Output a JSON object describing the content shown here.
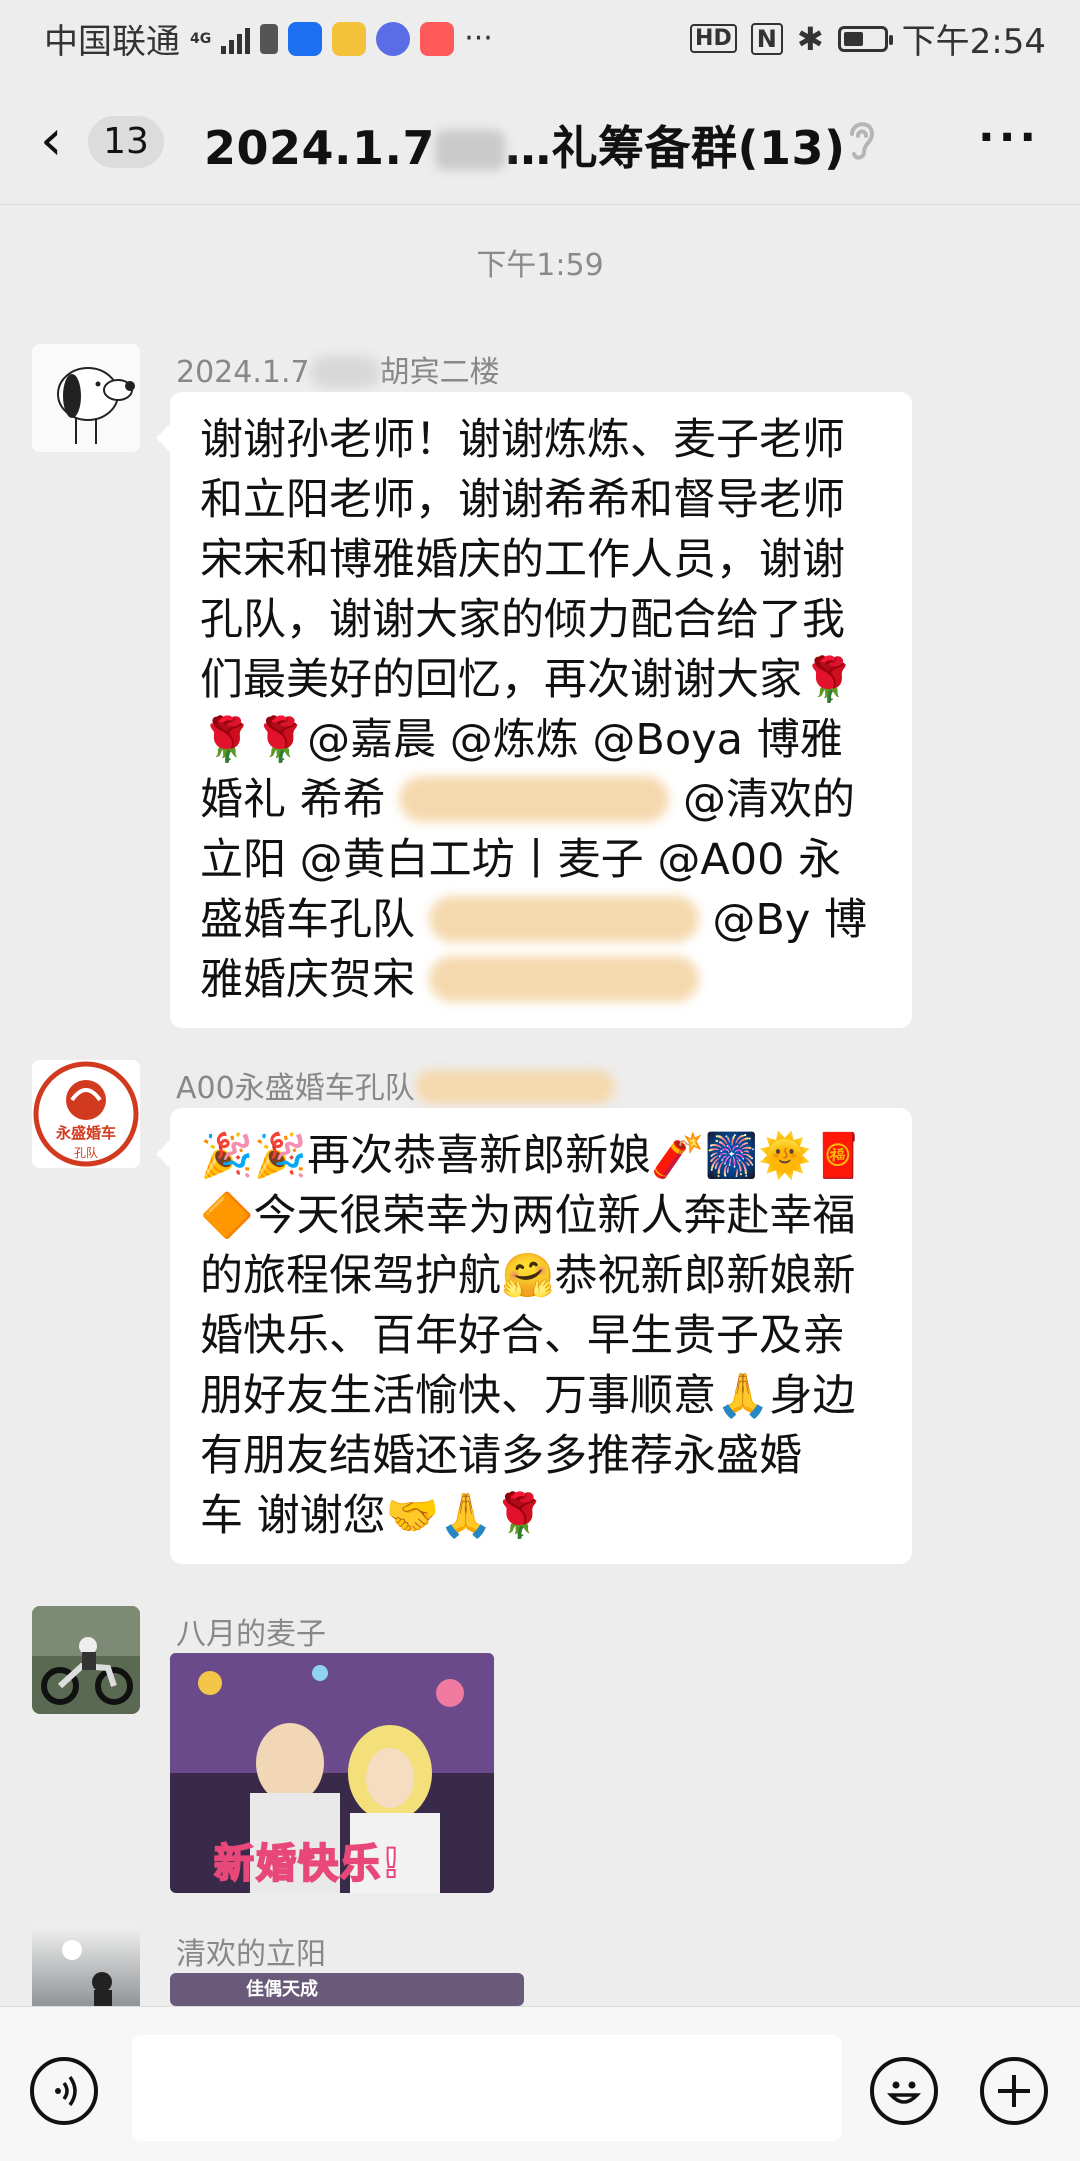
{
  "status_bar": {
    "carrier": "中国联通",
    "network": "4G",
    "time": "下午2:54",
    "battery_level": 0.5,
    "hd_label": "HD",
    "nfc_label": "N",
    "icons": [
      "signal-icon",
      "battery-saver-icon",
      "shield-app-icon",
      "weibo-icon",
      "music-icon",
      "tmall-icon",
      "more-notifications-icon",
      "hd-icon",
      "nfc-icon",
      "bluetooth-icon",
      "battery-icon"
    ],
    "more_notifications": "···"
  },
  "nav": {
    "back_icon": "chevron-left-icon",
    "unread_count": "13",
    "title_prefix": "2024.1.7",
    "title_suffix": "…礼筹备群(13)",
    "ear_icon": "earpiece-mode-icon",
    "more_icon": "···"
  },
  "timestamp": "下午1:59",
  "messages": [
    {
      "sender_prefix": "2024.1.7",
      "sender_suffix": "胡宾二楼",
      "avatar": "snoopy-avatar",
      "text_lines": [
        "谢谢孙老师！谢谢炼炼、麦子老师",
        "和立阳老师，谢谢希希和督导老师",
        "宋宋和博雅婚庆的工作人员，谢谢",
        "孔队，谢谢大家的倾力配合给了我",
        "们最美好的回忆，再次谢谢大家🌹",
        "🌹🌹@嘉晨 @炼炼 @Boya 博雅",
        "婚礼 希希",
        "@清欢的",
        "立阳 @黄白工坊丨麦子 @A00 永",
        "盛婚车孔队",
        "@By 博",
        "雅婚庆贺宋"
      ]
    },
    {
      "sender": "A00永盛婚车孔队",
      "avatar": "wedding-car-logo-avatar",
      "avatar_text": {
        "top": "永盛婚车",
        "sub": "孔队"
      },
      "text_lines": [
        "🎉🎉再次恭喜新郎新娘🧨🎆🌞🧧",
        "🔶今天很荣幸为两位新人奔赴幸福",
        "的旅程保驾护航🤗恭祝新郎新娘新",
        "婚快乐、百年好合、早生贵子及亲",
        "朋好友生活愉快、万事顺意🙏身边",
        "有朋友结婚还请多多推荐永盛婚",
        "车 谢谢您🤝🙏🌹"
      ]
    },
    {
      "sender": "八月的麦子",
      "avatar": "motorcycle-avatar",
      "image_caption": "新婚快乐!"
    },
    {
      "sender": "清欢的立阳",
      "avatar": "silhouette-sunset-avatar",
      "image_caption": "佳偶天成"
    }
  ],
  "input_bar": {
    "voice_icon": "voice-input-icon",
    "emoji_icon": "emoji-icon",
    "plus_icon": "plus-icon"
  }
}
